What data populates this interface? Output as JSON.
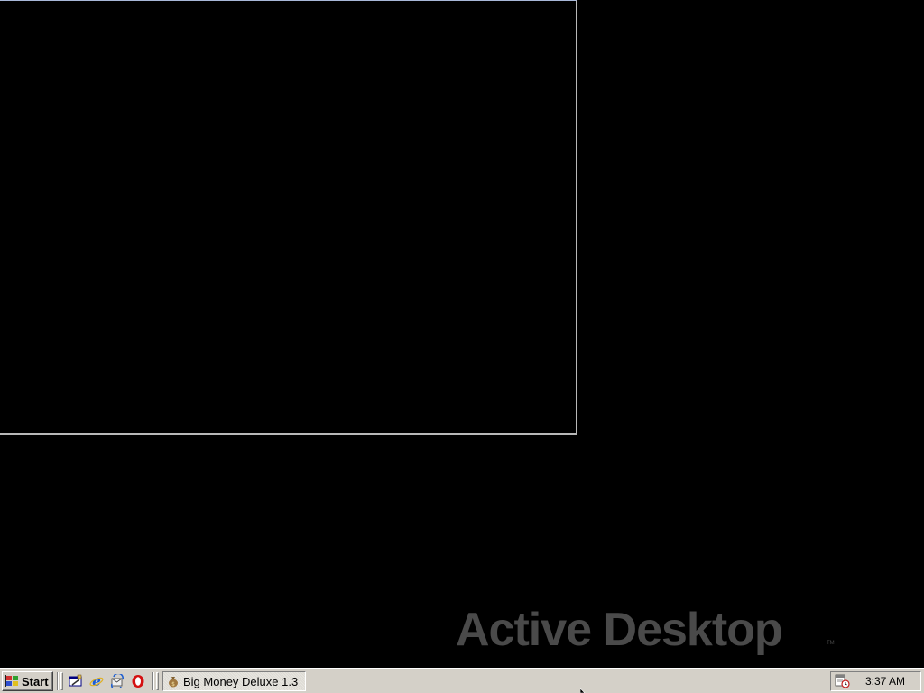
{
  "desktop": {
    "watermark_text": "Active Desktop",
    "watermark_tm": "TM",
    "background_color": "#000000"
  },
  "game_window": {
    "content": "blank black window"
  },
  "taskbar": {
    "start_label": "Start",
    "quick_launch": [
      {
        "icon": "show-desktop-icon"
      },
      {
        "icon": "internet-explorer-icon"
      },
      {
        "icon": "outlook-express-icon"
      },
      {
        "icon": "opera-icon"
      }
    ],
    "task_button_label": "Big Money Deluxe 1.3",
    "task_icon": "money-bag-icon",
    "tray_icon": "scheduler-icon",
    "clock": "3:37 AM",
    "background_color": "#d4d0c8"
  }
}
